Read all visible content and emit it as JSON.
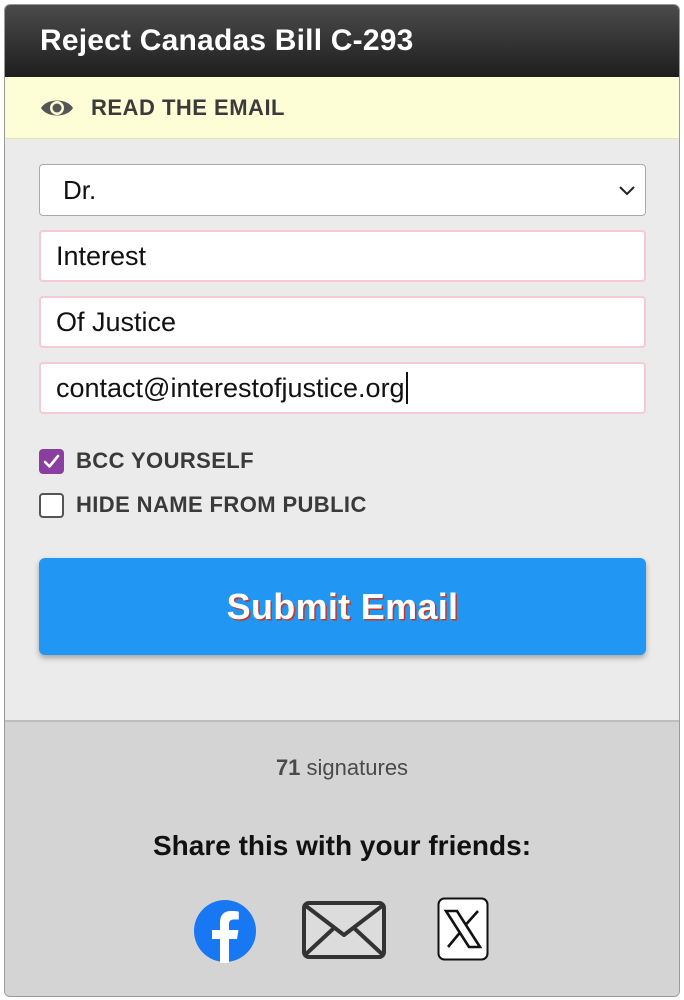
{
  "header": {
    "title": "Reject Canadas Bill C-293"
  },
  "read_bar": {
    "label": "READ THE EMAIL",
    "icon": "eye-icon"
  },
  "form": {
    "title_select": {
      "value": "Dr."
    },
    "first_name": {
      "value": "Interest"
    },
    "last_name": {
      "value": "Of Justice"
    },
    "email": {
      "value": "contact@interestofjustice.org"
    }
  },
  "checkboxes": [
    {
      "label": "BCC YOURSELF",
      "checked": true
    },
    {
      "label": "HIDE NAME FROM PUBLIC",
      "checked": false
    }
  ],
  "submit": {
    "label": "Submit Email"
  },
  "footer": {
    "signature_count": "71",
    "signature_label": "signatures",
    "share_heading": "Share this with your friends:",
    "share_icons": [
      "facebook-icon",
      "email-icon",
      "x-icon"
    ]
  },
  "colors": {
    "header_bg": "#2b2b2b",
    "read_bar_bg": "#fdfdd6",
    "checkbox_accent": "#8a3ea0",
    "submit_bg": "#2196f3",
    "facebook_blue": "#1877f2"
  }
}
